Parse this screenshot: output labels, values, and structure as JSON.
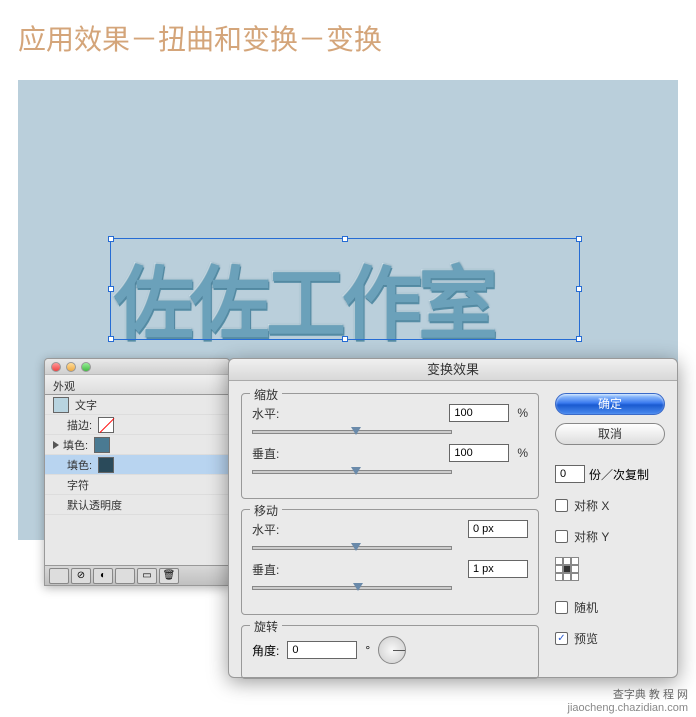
{
  "heading": "应用效果－扭曲和变换－变换",
  "artText": "佐佐工作室",
  "appearance": {
    "tab": "外观",
    "typeLabel": "文字",
    "strokeLabel": "描边:",
    "fillLabel": "填色:",
    "fillLabel2": "填色:",
    "charLabel": "字符",
    "opacityLabel": "默认透明度"
  },
  "dialog": {
    "title": "变换效果",
    "scale": {
      "legend": "缩放",
      "hLabel": "水平:",
      "hValue": "100",
      "hUnit": "%",
      "vLabel": "垂直:",
      "vValue": "100",
      "vUnit": "%"
    },
    "move": {
      "legend": "移动",
      "hLabel": "水平:",
      "hValue": "0 px",
      "vLabel": "垂直:",
      "vValue": "1 px"
    },
    "rotate": {
      "legend": "旋转",
      "angleLabel": "角度:",
      "angleValue": "0",
      "degree": "°"
    },
    "okLabel": "确定",
    "cancelLabel": "取消",
    "copiesValue": "0",
    "copiesLabel": "份／次复制",
    "reflectX": "对称 X",
    "reflectY": "对称 Y",
    "random": "随机",
    "preview": "预览",
    "previewChecked": true
  },
  "watermark": {
    "line1": "查字典 教 程 网",
    "line2": "jiaocheng.chazidian.com"
  }
}
